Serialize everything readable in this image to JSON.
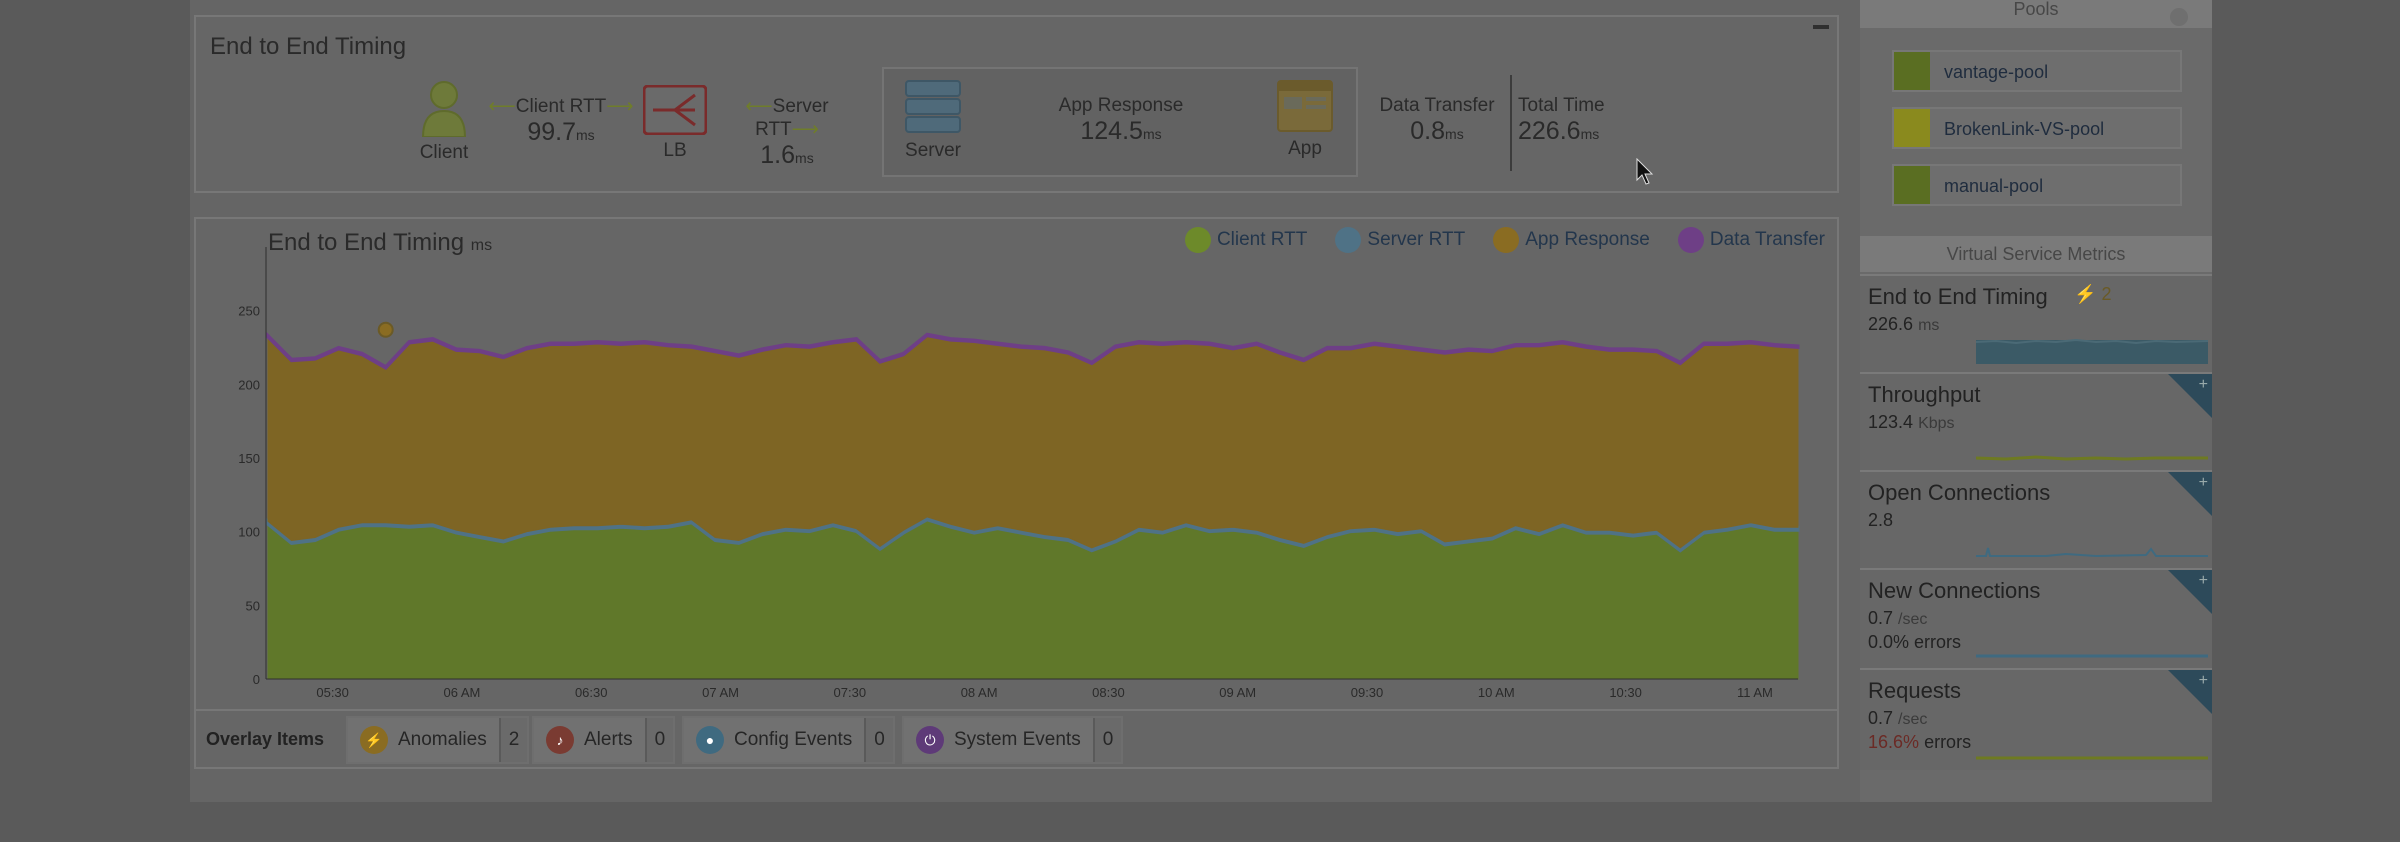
{
  "e2e": {
    "title": "End to End Timing",
    "client": {
      "label": "Client"
    },
    "client_rtt": {
      "label": "Client RTT",
      "value": "99.7",
      "unit": "ms"
    },
    "lb": {
      "label": "LB"
    },
    "server_rtt": {
      "label": "Server RTT",
      "value": "1.6",
      "unit": "ms"
    },
    "server": {
      "label": "Server"
    },
    "app_response": {
      "label": "App Response",
      "value": "124.5",
      "unit": "ms"
    },
    "app": {
      "label": "App"
    },
    "data_transfer": {
      "label": "Data Transfer",
      "value": "0.8",
      "unit": "ms"
    },
    "total_time": {
      "label": "Total Time",
      "value": "226.6",
      "unit": "ms"
    }
  },
  "chart": {
    "title": "End to End Timing",
    "title_unit": "ms",
    "legend": [
      {
        "name": "Client RTT",
        "color": "#6d8a2a"
      },
      {
        "name": "Server RTT",
        "color": "#4f7286"
      },
      {
        "name": "App Response",
        "color": "#8a6c22"
      },
      {
        "name": "Data Transfer",
        "color": "#6e3f86"
      }
    ]
  },
  "chart_data": {
    "type": "area",
    "stacked": true,
    "title": "End to End Timing",
    "ylabel": "ms",
    "ylim": [
      0,
      285
    ],
    "yticks": [
      0,
      50,
      100,
      150,
      200,
      250
    ],
    "x_tick_labels": [
      "05:30",
      "06 AM",
      "06:30",
      "07 AM",
      "07:30",
      "08 AM",
      "08:30",
      "09 AM",
      "09:30",
      "10 AM",
      "10:30",
      "11 AM"
    ],
    "x_start": "05:15",
    "x_end": "11:10",
    "series": [
      {
        "name": "Client RTT",
        "color": "#60782a",
        "values": [
          105,
          92,
          94,
          101,
          104,
          104,
          103,
          104,
          99,
          96,
          93,
          98,
          101,
          102,
          102,
          103,
          102,
          103,
          106,
          94,
          92,
          98,
          101,
          100,
          104,
          100,
          88,
          99,
          108,
          103,
          99,
          102,
          99,
          96,
          94,
          87,
          93,
          101,
          99,
          104,
          100,
          101,
          99,
          94,
          90,
          96,
          100,
          101,
          98,
          100,
          91,
          93,
          95,
          102,
          98,
          104,
          99,
          99,
          97,
          99,
          87,
          99,
          101,
          104,
          101,
          101
        ]
      },
      {
        "name": "Server RTT",
        "color": "#4f7286",
        "values": [
          2,
          2,
          2,
          2,
          2,
          2,
          2,
          2,
          2,
          2,
          2,
          2,
          2,
          2,
          2,
          2,
          2,
          2,
          2,
          2,
          2,
          2,
          2,
          2,
          2,
          2,
          2,
          2,
          2,
          2,
          2,
          2,
          2,
          2,
          2,
          2,
          2,
          2,
          2,
          2,
          2,
          2,
          2,
          2,
          2,
          2,
          2,
          2,
          2,
          2,
          2,
          2,
          2,
          2,
          2,
          2,
          2,
          2,
          2,
          2,
          2,
          2,
          2,
          2,
          2,
          2
        ]
      },
      {
        "name": "App Response",
        "color": "#7e6524",
        "values": [
          125,
          122,
          121,
          121,
          114,
          105,
          123,
          124,
          122,
          124,
          123,
          124,
          124,
          123,
          124,
          122,
          124,
          121,
          117,
          126,
          125,
          123,
          123,
          123,
          122,
          128,
          125,
          119,
          123,
          125,
          128,
          123,
          124,
          126,
          125,
          125,
          130,
          125,
          126,
          122,
          125,
          121,
          126,
          125,
          124,
          126,
          122,
          124,
          125,
          121,
          128,
          128,
          125,
          122,
          126,
          122,
          124,
          122,
          124,
          121,
          125,
          126,
          124,
          122,
          123,
          122
        ]
      },
      {
        "name": "Data Transfer",
        "color": "#6e3f86",
        "values": [
          1,
          1,
          1,
          1,
          1,
          1,
          1,
          1,
          1,
          1,
          1,
          1,
          1,
          1,
          1,
          1,
          1,
          1,
          1,
          1,
          1,
          1,
          1,
          1,
          1,
          1,
          1,
          1,
          1,
          1,
          1,
          1,
          1,
          1,
          1,
          1,
          1,
          1,
          1,
          1,
          1,
          1,
          1,
          1,
          1,
          1,
          1,
          1,
          1,
          1,
          1,
          1,
          1,
          1,
          1,
          1,
          1,
          1,
          1,
          1,
          1,
          1,
          1,
          1,
          1,
          1
        ]
      }
    ],
    "grid": false,
    "legend_position": "top-right"
  },
  "overlay": {
    "label": "Overlay Items",
    "items": [
      {
        "name": "Anomalies",
        "count": "2",
        "color": "#8a6c22",
        "icon": "anomaly-icon"
      },
      {
        "name": "Alerts",
        "count": "0",
        "color": "#7a3b32",
        "icon": "alert-bell-icon"
      },
      {
        "name": "Config Events",
        "count": "0",
        "color": "#3f6a80",
        "icon": "config-icon"
      },
      {
        "name": "System Events",
        "count": "0",
        "color": "#5e3a78",
        "icon": "system-power-icon"
      }
    ]
  },
  "sidebar": {
    "pools_header": "Pools",
    "pools": [
      {
        "name": "vantage-pool",
        "color": "#5a6e22"
      },
      {
        "name": "BrokenLink-VS-pool",
        "color": "#8a8a1e"
      },
      {
        "name": "manual-pool",
        "color": "#5a6e22"
      }
    ],
    "metrics_header": "Virtual Service Metrics",
    "metrics": [
      {
        "title": "End to End Timing",
        "value": "226.6",
        "unit": "ms",
        "badge": "2"
      },
      {
        "title": "Throughput",
        "value": "123.4",
        "unit": "Kbps"
      },
      {
        "title": "Open Connections",
        "value": "2.8",
        "unit": ""
      },
      {
        "title": "New Connections",
        "value": "0.7",
        "unit": "/sec",
        "errors_value": "0.0%",
        "errors_label": "errors"
      },
      {
        "title": "Requests",
        "value": "0.7",
        "unit": "/sec",
        "errors_value": "16.6%",
        "errors_label": "errors"
      }
    ]
  }
}
